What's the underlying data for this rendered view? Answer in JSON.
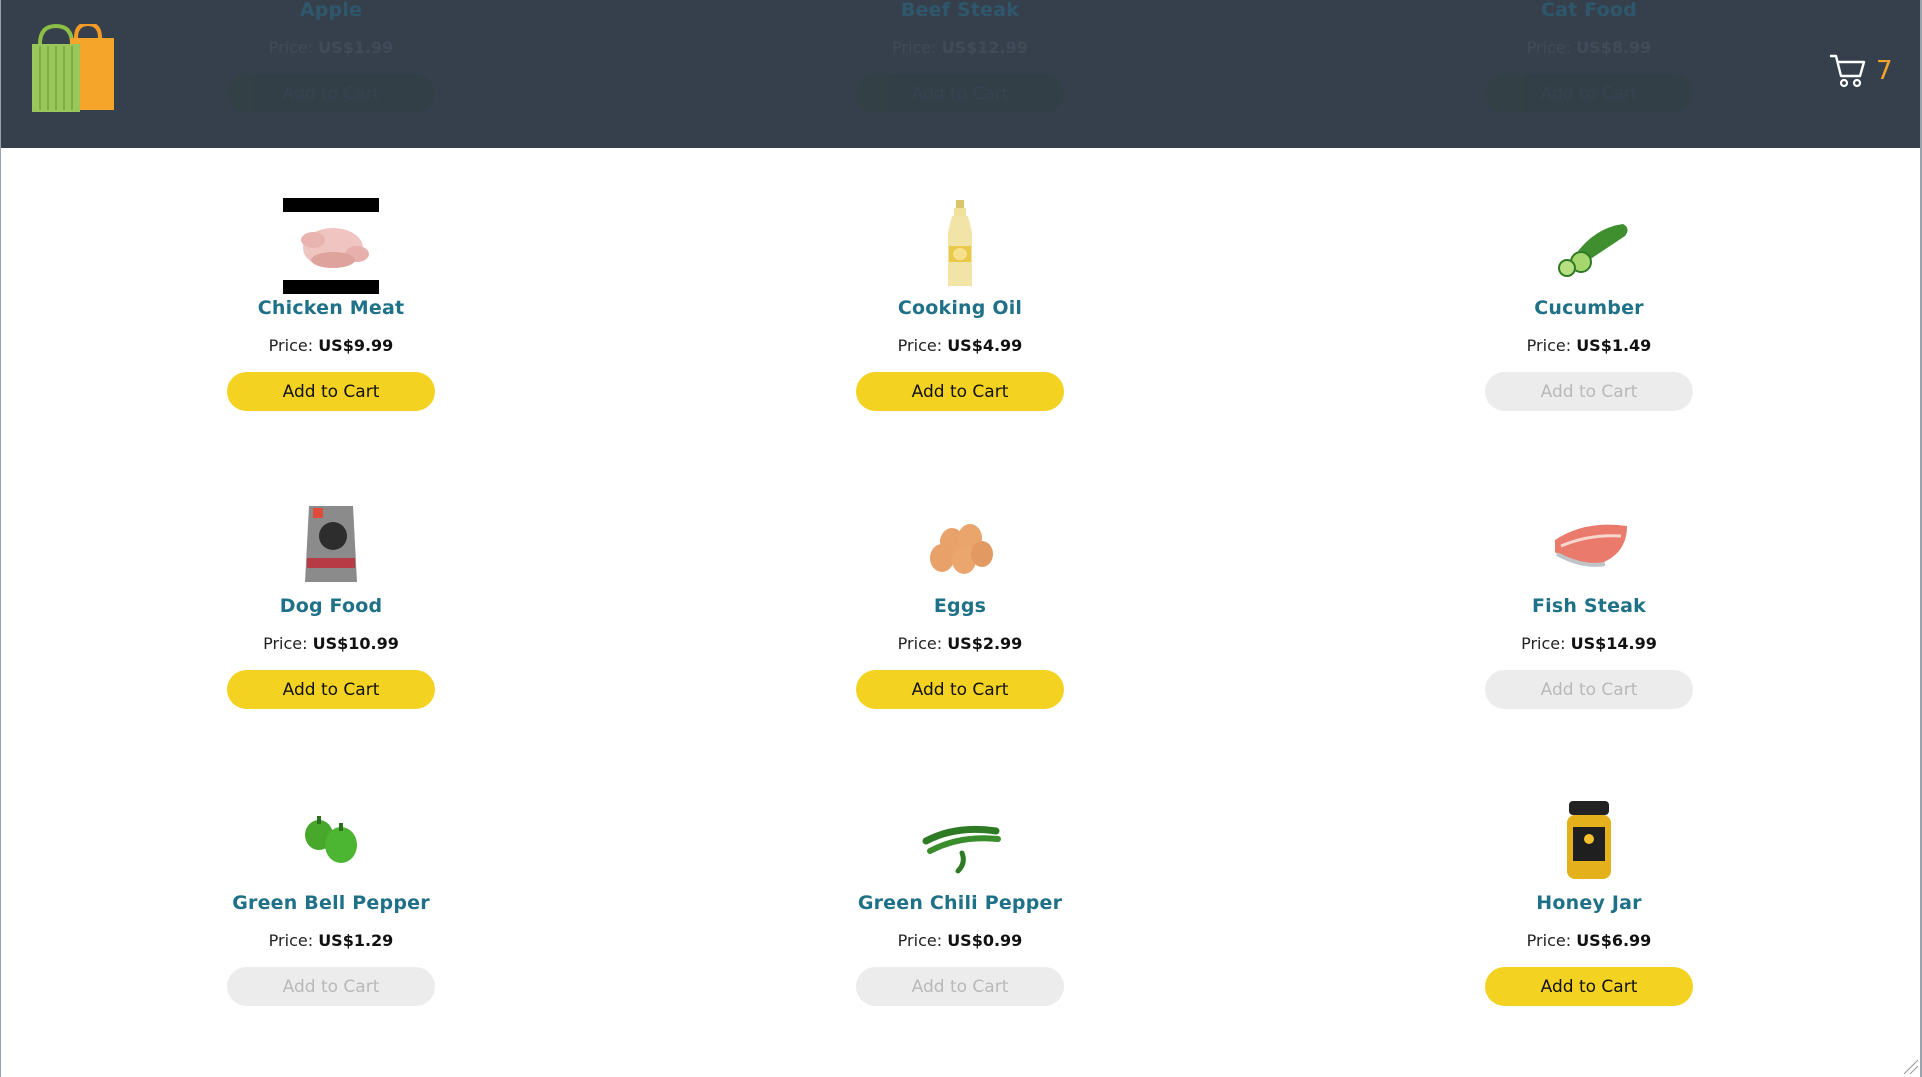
{
  "header": {
    "logo_icon": "shopping-bags-icon",
    "cart": {
      "icon": "shopping-cart-icon",
      "count": "7",
      "count_color": "#f4a52a"
    },
    "background": "#36404d"
  },
  "products_scrolled": [
    {
      "name": "Apple",
      "price_label": "Price:",
      "price": "US$1.99",
      "button": "Add to Cart"
    },
    {
      "name": "Beef Steak",
      "price_label": "Price:",
      "price": "US$12.99",
      "button": "Add to Cart"
    },
    {
      "name": "Cat Food",
      "price_label": "Price:",
      "price": "US$8.99",
      "button": "Add to Cart"
    }
  ],
  "products": [
    {
      "name": "Chicken Meat",
      "price_label": "Price:",
      "price": "US$9.99",
      "button": "Add to Cart",
      "enabled": true,
      "icon": "raw-chicken-icon"
    },
    {
      "name": "Cooking Oil",
      "price_label": "Price:",
      "price": "US$4.99",
      "button": "Add to Cart",
      "enabled": true,
      "icon": "oil-bottle-icon"
    },
    {
      "name": "Cucumber",
      "price_label": "Price:",
      "price": "US$1.49",
      "button": "Add to Cart",
      "enabled": false,
      "icon": "cucumber-icon"
    },
    {
      "name": "Dog Food",
      "price_label": "Price:",
      "price": "US$10.99",
      "button": "Add to Cart",
      "enabled": true,
      "icon": "dog-food-bag-icon"
    },
    {
      "name": "Eggs",
      "price_label": "Price:",
      "price": "US$2.99",
      "button": "Add to Cart",
      "enabled": true,
      "icon": "eggs-icon"
    },
    {
      "name": "Fish Steak",
      "price_label": "Price:",
      "price": "US$14.99",
      "button": "Add to Cart",
      "enabled": false,
      "icon": "fish-steak-icon"
    },
    {
      "name": "Green Bell Pepper",
      "price_label": "Price:",
      "price": "US$1.29",
      "button": "Add to Cart",
      "enabled": false,
      "icon": "bell-pepper-icon"
    },
    {
      "name": "Green Chili Pepper",
      "price_label": "Price:",
      "price": "US$0.99",
      "button": "Add to Cart",
      "enabled": false,
      "icon": "chili-pepper-icon"
    },
    {
      "name": "Honey Jar",
      "price_label": "Price:",
      "price": "US$6.99",
      "button": "Add to Cart",
      "enabled": true,
      "icon": "honey-jar-icon"
    }
  ],
  "colors": {
    "button_enabled": "#f4d221",
    "button_disabled": "#ececec",
    "product_name": "#1f7187"
  }
}
